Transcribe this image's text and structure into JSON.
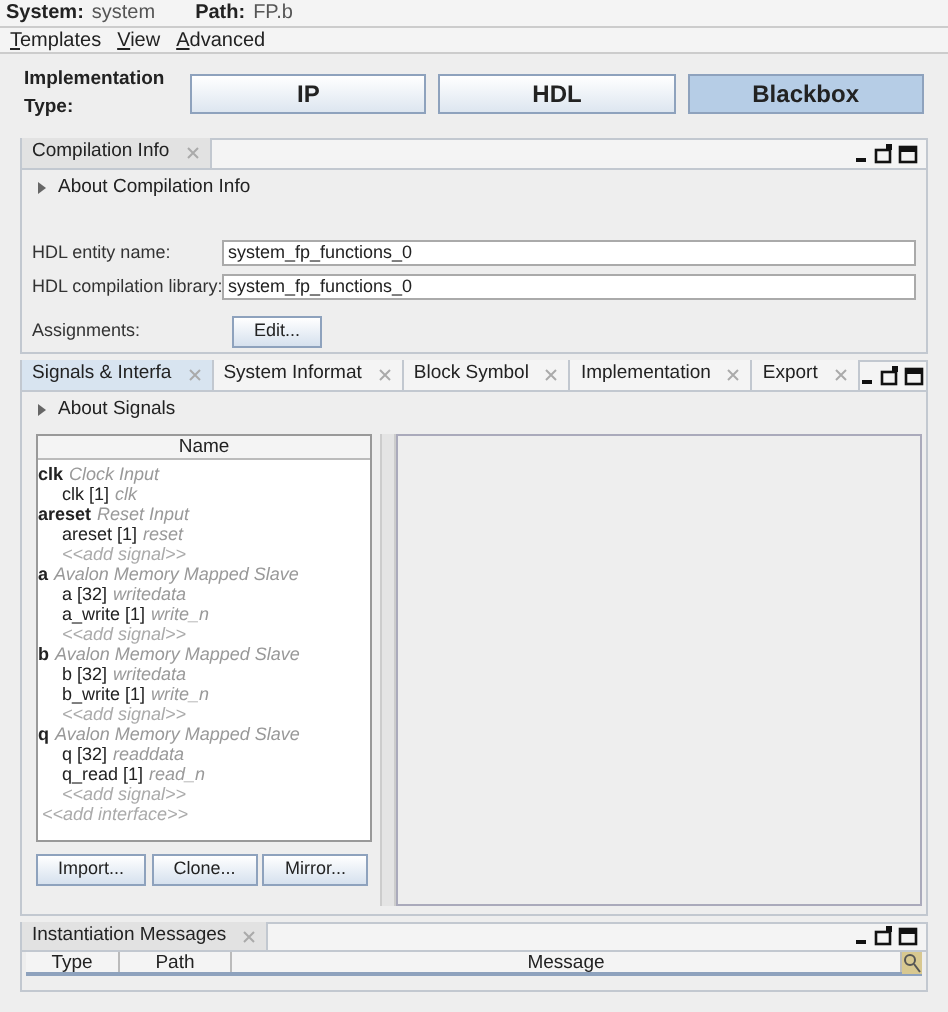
{
  "header": {
    "system_label": "System:",
    "system": "system",
    "path_label": "Path:",
    "path": "FP.b"
  },
  "menu": [
    "Templates",
    "View",
    "Advanced"
  ],
  "implementation": {
    "label": "Implementation Type:",
    "options": [
      {
        "label": "IP",
        "selected": false
      },
      {
        "label": "HDL",
        "selected": false
      },
      {
        "label": "Blackbox",
        "selected": true
      }
    ]
  },
  "compilation_panel": {
    "tab": "Compilation Info",
    "about": "About Compilation Info",
    "fields": [
      {
        "label": "HDL entity name:",
        "value": "system_fp_functions_0"
      },
      {
        "label": "HDL compilation library:",
        "value": "system_fp_functions_0"
      }
    ],
    "assignments_label": "Assignments:",
    "assignments_button": "Edit..."
  },
  "signals_panel": {
    "tabs": [
      {
        "label": "Signals & Interfa",
        "selected": true
      },
      {
        "label": "System Informat",
        "selected": false
      },
      {
        "label": "Block Symbol",
        "selected": false
      },
      {
        "label": "Implementation",
        "selected": false
      },
      {
        "label": "Export",
        "selected": false
      }
    ],
    "about": "About Signals",
    "tree_header": "Name",
    "tree": [
      {
        "kind": "interface",
        "name": "clk",
        "type": "Clock Input",
        "children": [
          {
            "kind": "signal",
            "name": "clk [1]",
            "role": "clk"
          }
        ]
      },
      {
        "kind": "interface",
        "name": "areset",
        "type": "Reset Input",
        "children": [
          {
            "kind": "signal",
            "name": "areset [1]",
            "role": "reset"
          },
          {
            "kind": "add",
            "name": "<<add signal>>"
          }
        ]
      },
      {
        "kind": "interface",
        "name": "a",
        "type": "Avalon Memory Mapped Slave",
        "children": [
          {
            "kind": "signal",
            "name": "a [32]",
            "role": "writedata"
          },
          {
            "kind": "signal",
            "name": "a_write [1]",
            "role": "write_n"
          },
          {
            "kind": "add",
            "name": "<<add signal>>"
          }
        ]
      },
      {
        "kind": "interface",
        "name": "b",
        "type": "Avalon Memory Mapped Slave",
        "children": [
          {
            "kind": "signal",
            "name": "b [32]",
            "role": "writedata"
          },
          {
            "kind": "signal",
            "name": "b_write [1]",
            "role": "write_n"
          },
          {
            "kind": "add",
            "name": "<<add signal>>"
          }
        ]
      },
      {
        "kind": "interface",
        "name": "q",
        "type": "Avalon Memory Mapped Slave",
        "children": [
          {
            "kind": "signal",
            "name": "q [32]",
            "role": "readdata"
          },
          {
            "kind": "signal",
            "name": "q_read [1]",
            "role": "read_n"
          },
          {
            "kind": "add",
            "name": "<<add signal>>"
          }
        ]
      },
      {
        "kind": "add",
        "name": "<<add interface>>"
      }
    ],
    "buttons": [
      "Import...",
      "Clone...",
      "Mirror..."
    ]
  },
  "messages_panel": {
    "tab": "Instantiation Messages",
    "columns": [
      "Type",
      "Path",
      "Message"
    ]
  }
}
